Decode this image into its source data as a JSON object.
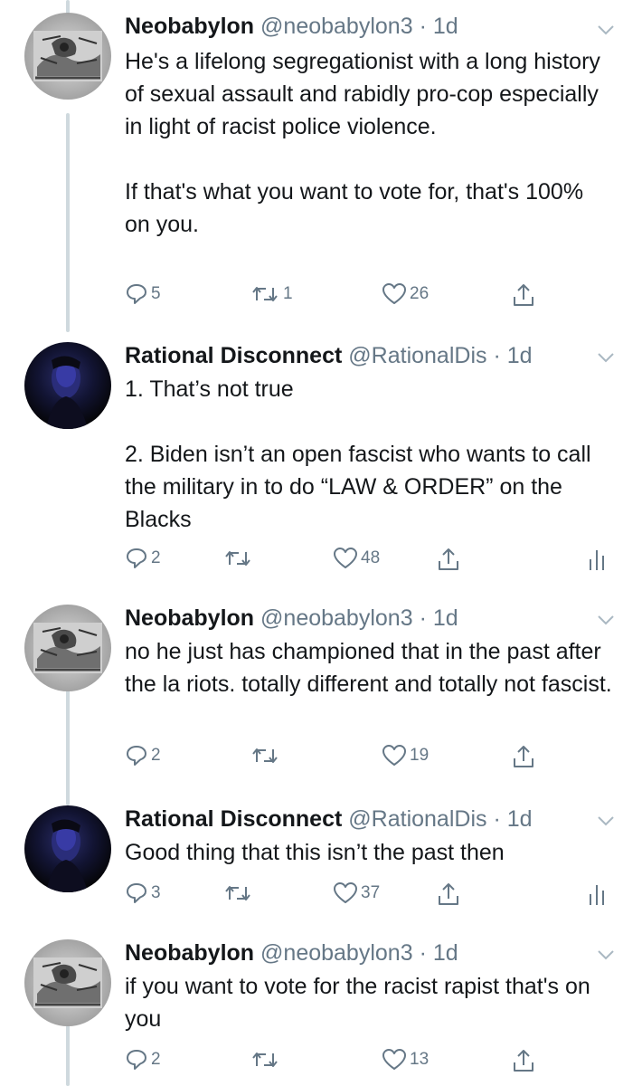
{
  "tweets": [
    {
      "name": "Neobabylon",
      "handle": "@neobabylon3",
      "dot": "·",
      "time": "1d",
      "avatar": "neobabylon-avatar",
      "text": "He's a lifelong segregationist with a long history of sexual assault and rabidly pro-cop especially in light of racist police violence.\n\nIf that's what you want to vote for, that's 100% on you.",
      "replies": "5",
      "retweets": "1",
      "likes": "26",
      "analytics": false
    },
    {
      "name": "Rational Disconnect",
      "handle": "@RationalDis",
      "dot": "·",
      "time": "1d",
      "avatar": "rational-disconnect-avatar",
      "text": "1. That’s not true\n\n2. Biden isn’t an open fascist who wants to call the military in to do “LAW & ORDER” on the Blacks",
      "replies": "2",
      "retweets": "",
      "likes": "48",
      "analytics": true
    },
    {
      "name": "Neobabylon",
      "handle": "@neobabylon3",
      "dot": "·",
      "time": "1d",
      "avatar": "neobabylon-avatar",
      "text": "no he just has championed that in the past after the la riots. totally different and totally not fascist.",
      "replies": "2",
      "retweets": "",
      "likes": "19",
      "analytics": false
    },
    {
      "name": "Rational Disconnect",
      "handle": "@RationalDis",
      "dot": "·",
      "time": "1d",
      "avatar": "rational-disconnect-avatar",
      "text": "Good thing that this isn’t the past then",
      "replies": "3",
      "retweets": "",
      "likes": "37",
      "analytics": true
    },
    {
      "name": "Neobabylon",
      "handle": "@neobabylon3",
      "dot": "·",
      "time": "1d",
      "avatar": "neobabylon-avatar",
      "text": "if you want to vote for the racist rapist that's on you",
      "replies": "2",
      "retweets": "",
      "likes": "13",
      "analytics": false
    }
  ],
  "icons": {
    "reply": "reply-icon",
    "retweet": "retweet-icon",
    "like": "heart-icon",
    "share": "share-icon",
    "analytics": "analytics-icon",
    "caret": "chevron-down-icon"
  },
  "colors": {
    "text": "#14171a",
    "secondary": "#657786",
    "thread_line": "#cfd9de"
  }
}
